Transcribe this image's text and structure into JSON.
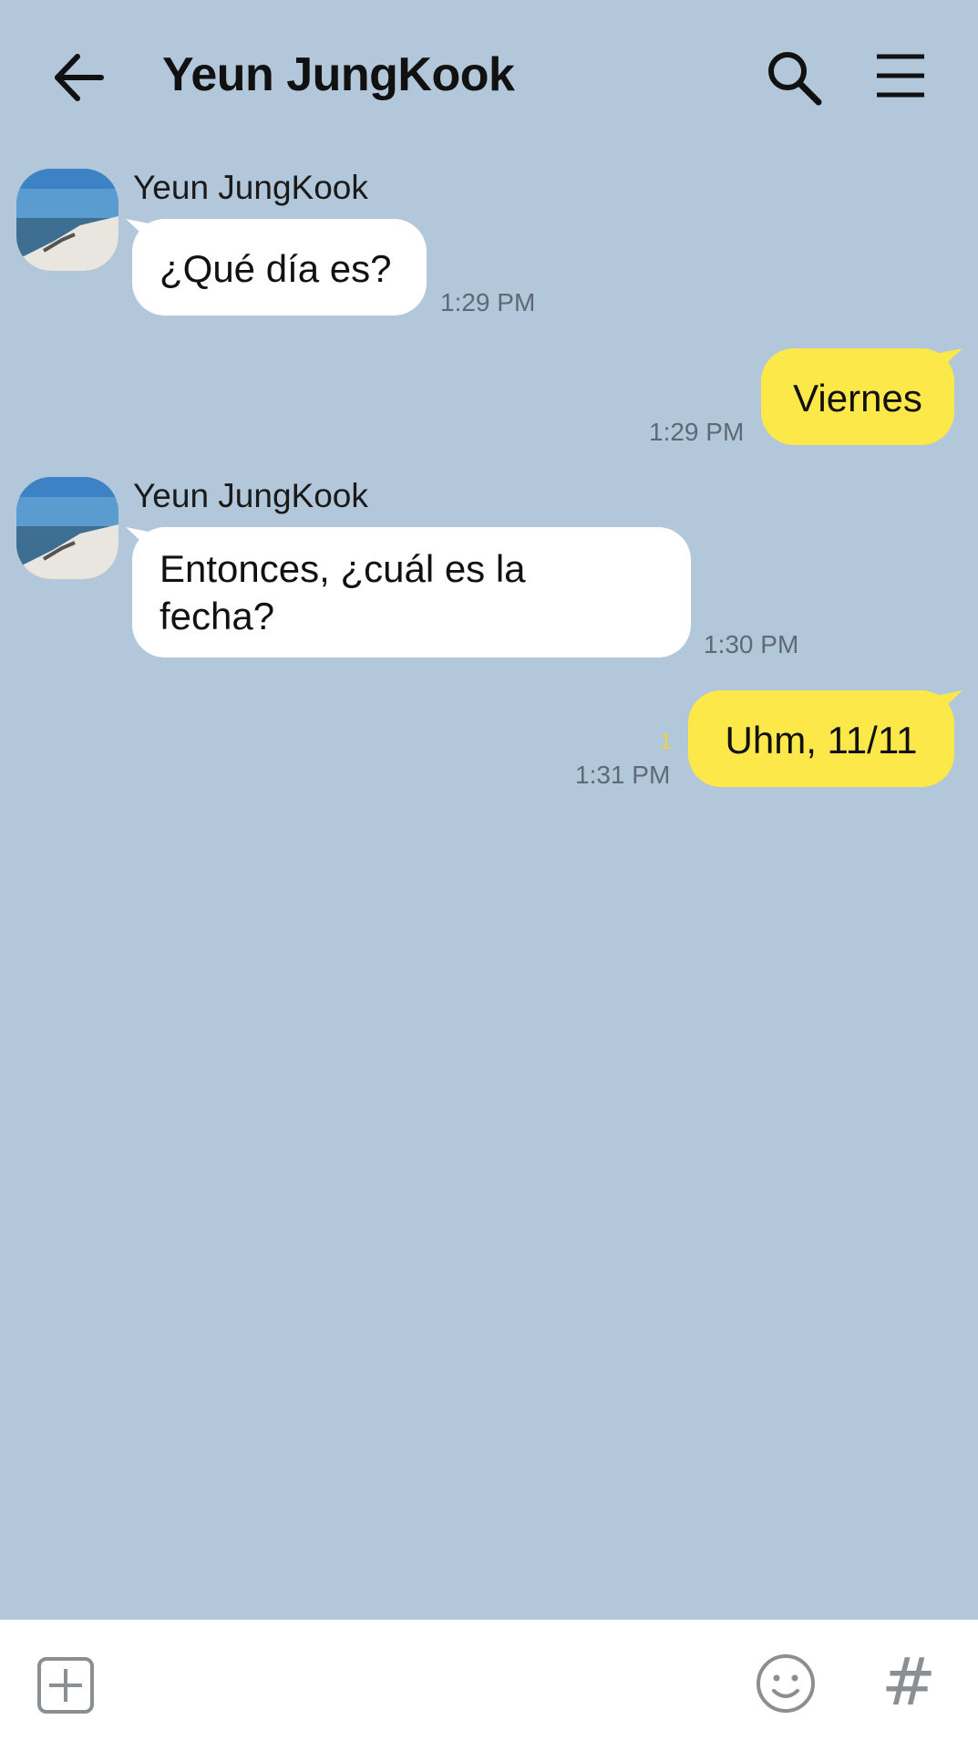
{
  "header": {
    "title": "Yeun JungKook",
    "back_icon": "arrow-left-icon",
    "search_icon": "search-icon",
    "menu_icon": "hamburger-menu-icon"
  },
  "messages": [
    {
      "direction": "in",
      "sender": "Yeun JungKook",
      "text": "¿Qué día es?",
      "time": "1:29 PM"
    },
    {
      "direction": "out",
      "text": "Viernes",
      "time": "1:29 PM"
    },
    {
      "direction": "in",
      "sender": "Yeun JungKook",
      "text_lines": [
        "Entonces, ¿cuál es la",
        "fecha?"
      ],
      "time": "1:30 PM"
    },
    {
      "direction": "out",
      "text": "Uhm, 11/11",
      "time": "1:31 PM",
      "unread_count": "1"
    }
  ],
  "input_bar": {
    "plus_icon": "add-square-icon",
    "emoji_icon": "smiley-icon",
    "hash_label": "#"
  },
  "colors": {
    "background": "#b2c7da",
    "incoming_bubble": "#ffffff",
    "outgoing_bubble": "#fde84a",
    "unread": "#e8d832"
  }
}
